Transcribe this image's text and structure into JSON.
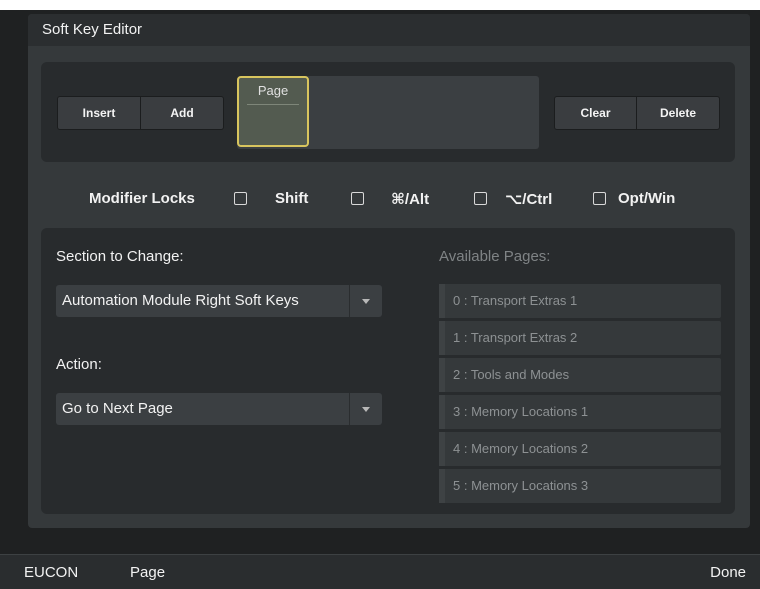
{
  "window": {
    "title": "Soft Key Editor"
  },
  "toolbar": {
    "insert_label": "Insert",
    "add_label": "Add",
    "clear_label": "Clear",
    "delete_label": "Delete",
    "page_tile_label": "Page"
  },
  "modifiers": {
    "label": "Modifier Locks",
    "items": [
      {
        "label": "Shift",
        "checked": false
      },
      {
        "label": "⌘/Alt",
        "checked": false
      },
      {
        "label": "⌥/Ctrl",
        "checked": false
      },
      {
        "label": "Opt/Win",
        "checked": false
      }
    ]
  },
  "section": {
    "label": "Section to Change:",
    "value": "Automation Module Right Soft Keys"
  },
  "action": {
    "label": "Action:",
    "value": "Go to Next Page"
  },
  "available_pages": {
    "title": "Available Pages:",
    "items": [
      "0 : Transport Extras 1",
      "1 : Transport Extras 2",
      "2 : Tools and Modes",
      "3 : Memory Locations 1",
      "4 : Memory Locations 2",
      "5 : Memory Locations 3"
    ]
  },
  "statusbar": {
    "left1": "EUCON",
    "left2": "Page",
    "right": "Done"
  },
  "colors": {
    "accent_outline": "#d8c55e",
    "panel_bg": "#282b2d",
    "window_bg": "#35393b"
  }
}
